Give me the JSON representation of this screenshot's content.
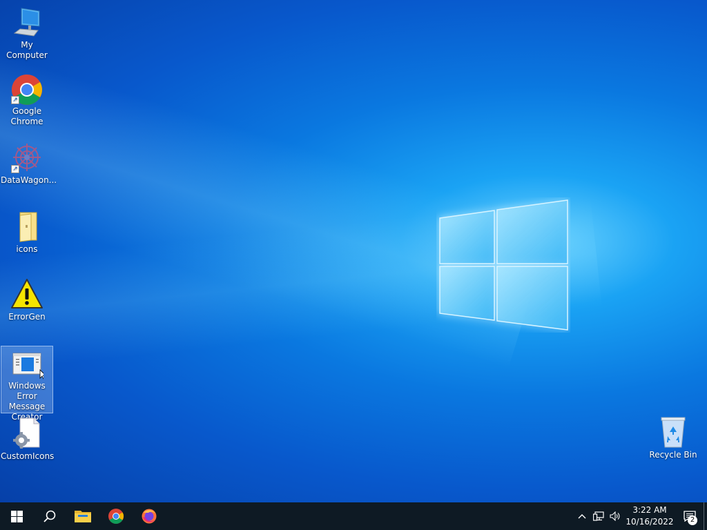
{
  "desktop": {
    "icons": [
      {
        "label": "My Computer",
        "icon": "computer-icon",
        "shortcut": false
      },
      {
        "label": "Google\nChrome",
        "icon": "chrome-icon",
        "shortcut": true
      },
      {
        "label": "DataWagon...",
        "icon": "datawagon-icon",
        "shortcut": true
      },
      {
        "label": "icons",
        "icon": "folder-icon",
        "shortcut": false
      },
      {
        "label": "ErrorGen",
        "icon": "warning-icon",
        "shortcut": false
      },
      {
        "label": "Windows\nError Message\nCreator",
        "icon": "error-message-creator-icon",
        "shortcut": false,
        "selected": true
      },
      {
        "label": "CustomIcons",
        "icon": "settings-file-icon",
        "shortcut": false
      }
    ],
    "recycle_bin": {
      "label": "Recycle Bin",
      "icon": "recycle-bin-icon"
    }
  },
  "taskbar": {
    "start": {
      "icon": "windows-start-icon"
    },
    "search": {
      "icon": "search-icon"
    },
    "pinned": [
      {
        "name": "File Explorer",
        "icon": "file-explorer-icon"
      },
      {
        "name": "Google Chrome",
        "icon": "chrome-icon"
      },
      {
        "name": "Firefox",
        "icon": "firefox-icon"
      }
    ],
    "tray": {
      "chevron": "chevron-up-icon",
      "network": "network-icon",
      "volume": "volume-icon",
      "time": "3:22 AM",
      "date": "10/16/2022",
      "notifications_count": "2"
    }
  },
  "colors": {
    "taskbar_bg": "#0e1a24",
    "desktop_bg": "#0a78e0",
    "logo_light": "#7fd8ff"
  }
}
